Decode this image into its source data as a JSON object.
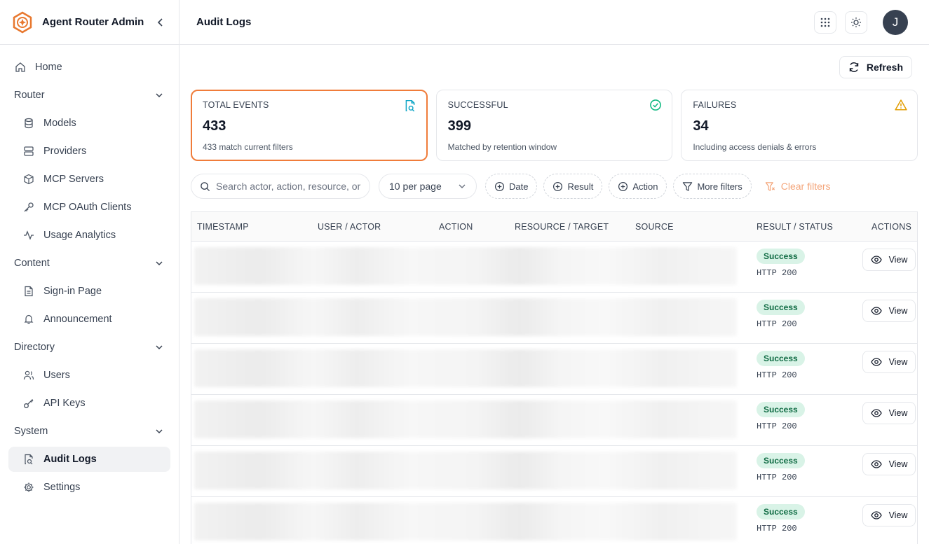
{
  "app": {
    "title": "Agent Router Admin"
  },
  "sidebar": {
    "home": "Home",
    "sections": {
      "router": {
        "label": "Router",
        "items": [
          "Models",
          "Providers",
          "MCP Servers",
          "MCP OAuth Clients",
          "Usage Analytics"
        ]
      },
      "content": {
        "label": "Content",
        "items": [
          "Sign-in Page",
          "Announcement"
        ]
      },
      "directory": {
        "label": "Directory",
        "items": [
          "Users",
          "API Keys"
        ]
      },
      "system": {
        "label": "System",
        "items": [
          "Audit Logs",
          "Settings"
        ]
      }
    }
  },
  "topbar": {
    "page_title": "Audit Logs",
    "avatar_initial": "J"
  },
  "toolbar": {
    "refresh_label": "Refresh"
  },
  "stats": {
    "total": {
      "label": "TOTAL EVENTS",
      "value": "433",
      "sub": "433 match current filters"
    },
    "success": {
      "label": "SUCCESSFUL",
      "value": "399",
      "sub": "Matched by retention window"
    },
    "failures": {
      "label": "FAILURES",
      "value": "34",
      "sub": "Including access denials & errors"
    }
  },
  "filters": {
    "search_placeholder": "Search actor, action, resource, or",
    "per_page": "10 per page",
    "date": "Date",
    "result": "Result",
    "action": "Action",
    "more": "More filters",
    "clear": "Clear filters"
  },
  "table": {
    "columns": [
      "TIMESTAMP",
      "USER / ACTOR",
      "ACTION",
      "RESOURCE / TARGET",
      "SOURCE",
      "RESULT / STATUS",
      "ACTIONS"
    ],
    "rows": [
      {
        "result": "Success",
        "status": "HTTP 200",
        "action_label": "View"
      },
      {
        "result": "Success",
        "status": "HTTP 200",
        "action_label": "View"
      },
      {
        "result": "Success",
        "status": "HTTP 200",
        "action_label": "View"
      },
      {
        "result": "Success",
        "status": "HTTP 200",
        "action_label": "View"
      },
      {
        "result": "Success",
        "status": "HTTP 200",
        "action_label": "View"
      },
      {
        "result": "Success",
        "status": "HTTP 200",
        "action_label": "View"
      }
    ]
  },
  "colors": {
    "accent": "#f07c3a",
    "success_bg": "#d9f3e7",
    "success_text": "#0f6b43",
    "warning": "#e3a008",
    "info": "#0ea5c6"
  }
}
